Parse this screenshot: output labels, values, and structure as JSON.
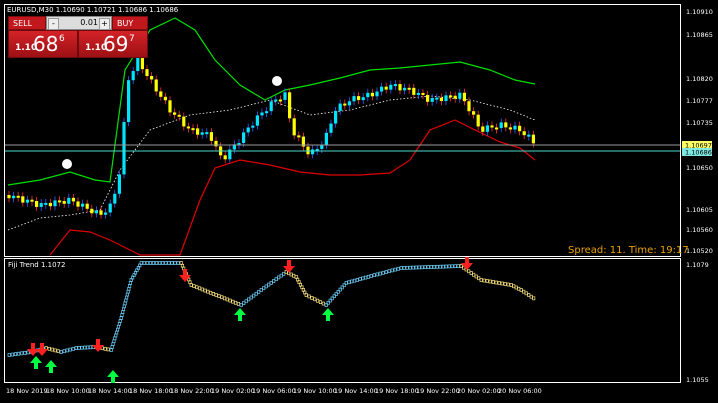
{
  "header": {
    "symbol_info": "EURUSD,M30  1.10690 1.10721 1.10686 1.10686"
  },
  "trade_panel": {
    "sell_label": "SELL",
    "buy_label": "BUY",
    "lot_minus": "-",
    "lot_plus": "+",
    "lot_value": "0.01",
    "sell_price": {
      "prefix": "1.10",
      "big": "68",
      "pip": "6"
    },
    "buy_price": {
      "prefix": "1.10",
      "big": "69",
      "pip": "7"
    }
  },
  "status_text": "Spread: 11. Time: 19:17",
  "main_axis": {
    "labels": [
      "1.10910",
      "1.10865",
      "1.10820",
      "1.10777",
      "1.10735",
      "1.10650",
      "1.10605",
      "1.10560",
      "1.10520"
    ],
    "current_ask": "1.10697",
    "current_bid": "1.10686"
  },
  "sub_window": {
    "title": "Fiji Trend 1.1072",
    "axis_top": "1.1079",
    "axis_bottom": "1.1055"
  },
  "time_axis": [
    "18 Nov 2019",
    "18 Nov 10:00",
    "18 Nov 14:00",
    "18 Nov 18:00",
    "18 Nov 22:00",
    "19 Nov 02:00",
    "19 Nov 06:00",
    "19 Nov 10:00",
    "19 Nov 14:00",
    "19 Nov 18:00",
    "19 Nov 22:00",
    "20 Nov 02:00",
    "20 Nov 06:00"
  ],
  "colors": {
    "bull_candle": "#00e5ff",
    "bear_candle": "#ffff00",
    "upper_band": "#00e000",
    "lower_band": "#e00000",
    "mid_band": "#ffffff",
    "buy_arrow": "#00ff40",
    "sell_arrow": "#ff2020",
    "status": "#e8a200"
  }
}
